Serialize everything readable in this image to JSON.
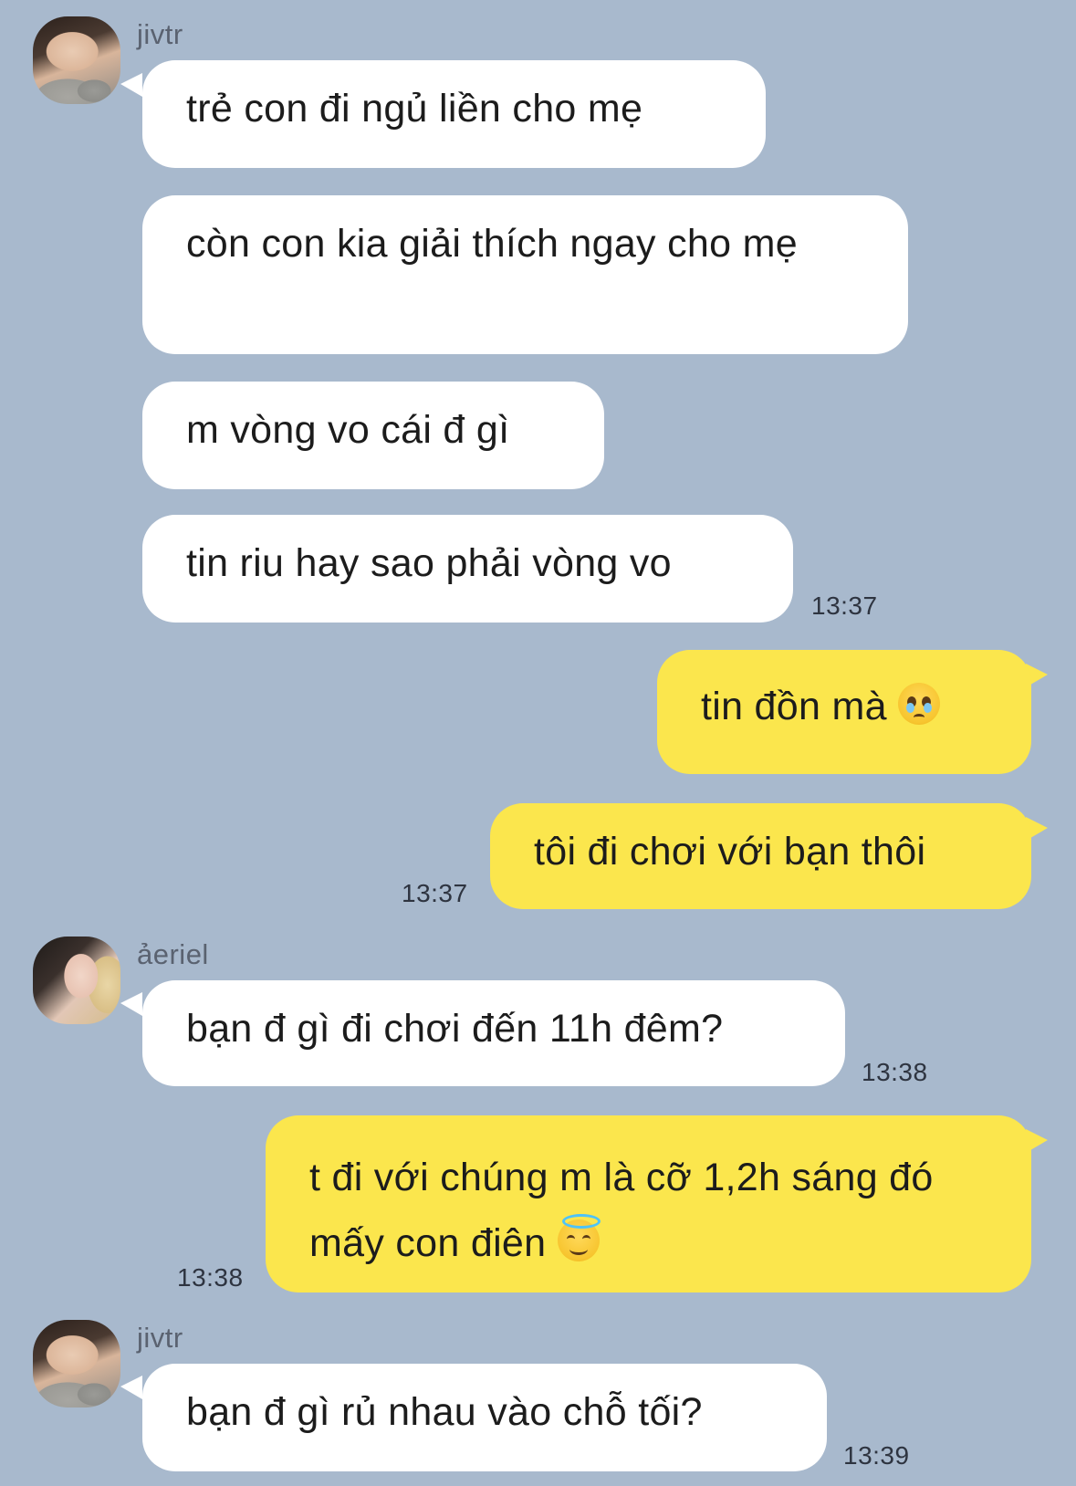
{
  "chat": {
    "background_color": "#a8b9cd",
    "incoming_bubble_color": "#ffffff",
    "outgoing_bubble_color": "#fbe64d",
    "groups": [
      {
        "sender": "jivtr",
        "messages": [
          "trẻ con đi ngủ liền cho mẹ",
          "còn con kia giải thích ngay cho mẹ",
          "m vòng vo cái đ gì",
          "tin riu hay sao phải vòng vo"
        ],
        "time": "13:37"
      },
      {
        "sender": "me",
        "messages": [
          "tin đồn mà",
          "tôi đi chơi với bạn thôi"
        ],
        "emoji": [
          "pleading-face-icon"
        ],
        "time": "13:37"
      },
      {
        "sender": "ảeriel",
        "messages": [
          "bạn đ gì đi chơi đến 11h đêm?"
        ],
        "time": "13:38"
      },
      {
        "sender": "me",
        "messages": [
          "t đi với chúng m là cỡ 1,2h sáng đó mấy con điên"
        ],
        "emoji": [
          "smiling-face-with-halo-icon"
        ],
        "time": "13:38"
      },
      {
        "sender": "jivtr",
        "messages": [
          "bạn đ gì rủ nhau vào chỗ tối?"
        ],
        "time": "13:39"
      }
    ]
  }
}
